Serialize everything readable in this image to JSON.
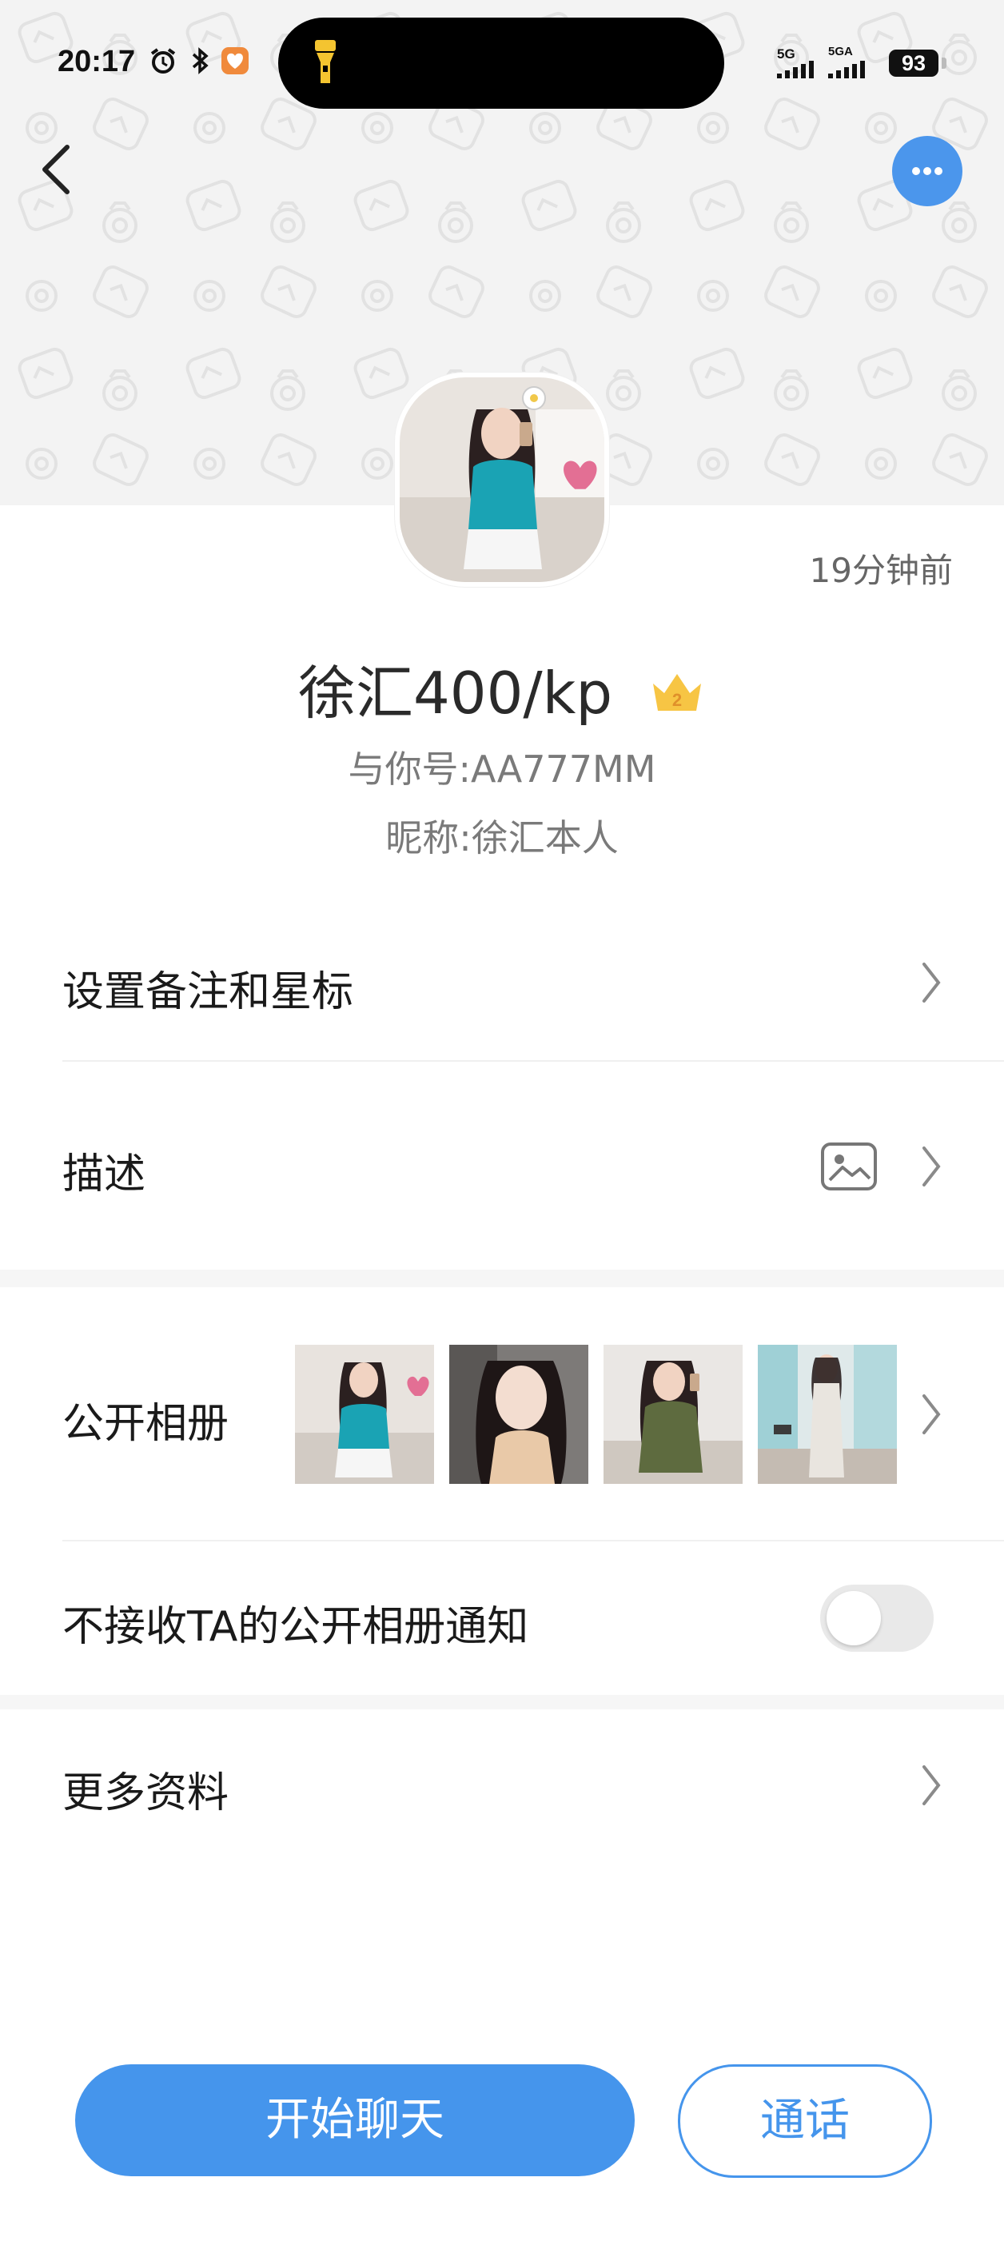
{
  "status_bar": {
    "time": "20:17",
    "network_1": "5G",
    "network_2": "5GA",
    "battery": "93",
    "icons": [
      "alarm-icon",
      "bluetooth-icon",
      "app-heart-icon",
      "flashlight-icon"
    ]
  },
  "header": {
    "back_icon": "chevron-left-icon",
    "more_icon": "more-dots-icon",
    "background_pattern": "camera-doodle-pattern"
  },
  "profile": {
    "last_seen": "19分钟前",
    "name": "徐汇400/kp",
    "vip_badge": "2",
    "account_id": "与你号:AA777MM",
    "nickname": "昵称:徐汇本人"
  },
  "menu": {
    "remark_label": "设置备注和星标",
    "description_label": "描述",
    "album_label": "公开相册",
    "album_photo_count_shown": 4,
    "album_notify_label": "不接收TA的公开相册通知",
    "album_notify_enabled": false,
    "more_info_label": "更多资料"
  },
  "actions": {
    "chat_label": "开始聊天",
    "call_label": "通话"
  },
  "colors": {
    "accent": "#4595ec",
    "header_bg": "#f3f3f3",
    "text_primary": "#1a1a1a",
    "text_secondary": "#7a7a7a"
  }
}
